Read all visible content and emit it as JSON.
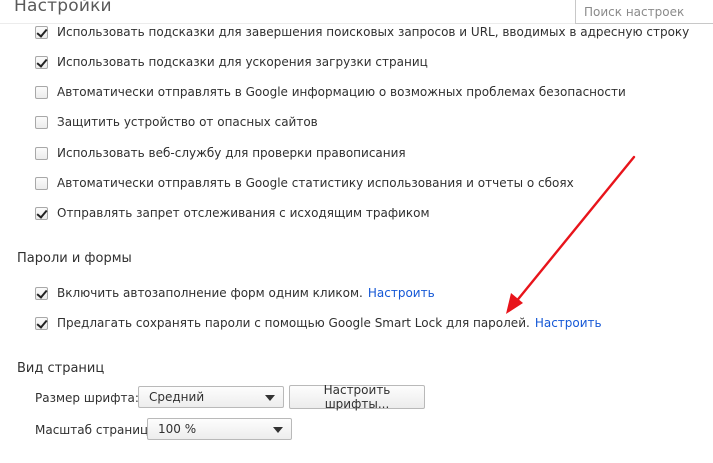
{
  "header": {
    "title": "Настройки",
    "search_placeholder": "Поиск настроек"
  },
  "privacy_items": [
    {
      "label": "Использовать подсказки для завершения поисковых запросов и URL, вводимых в адресную строку",
      "checked": true
    },
    {
      "label": "Использовать подсказки для ускорения загрузки страниц",
      "checked": true
    },
    {
      "label": "Автоматически отправлять в Google информацию о возможных проблемах безопасности",
      "checked": false
    },
    {
      "label": "Защитить устройство от опасных сайтов",
      "checked": false
    },
    {
      "label": "Использовать веб-службу для проверки правописания",
      "checked": false
    },
    {
      "label": "Автоматически отправлять в Google статистику использования и отчеты о сбоях",
      "checked": false
    },
    {
      "label": "Отправлять запрет отслеживания с исходящим трафиком",
      "checked": true
    }
  ],
  "passwords_section": {
    "title": "Пароли и формы",
    "items": [
      {
        "label": "Включить автозаполнение форм одним кликом.",
        "link": "Настроить",
        "checked": true
      },
      {
        "label": "Предлагать сохранять пароли с помощью Google Smart Lock для паролей.",
        "link": "Настроить",
        "checked": true
      }
    ]
  },
  "appearance_section": {
    "title": "Вид страниц",
    "font_size_label": "Размер шрифта:",
    "font_size_value": "Средний",
    "customize_fonts_button": "Настроить шрифты...",
    "zoom_label": "Масштаб страницы:",
    "zoom_value": "100 %"
  },
  "colors": {
    "link": "#1558d6",
    "annotation_arrow": "#e8141b"
  }
}
